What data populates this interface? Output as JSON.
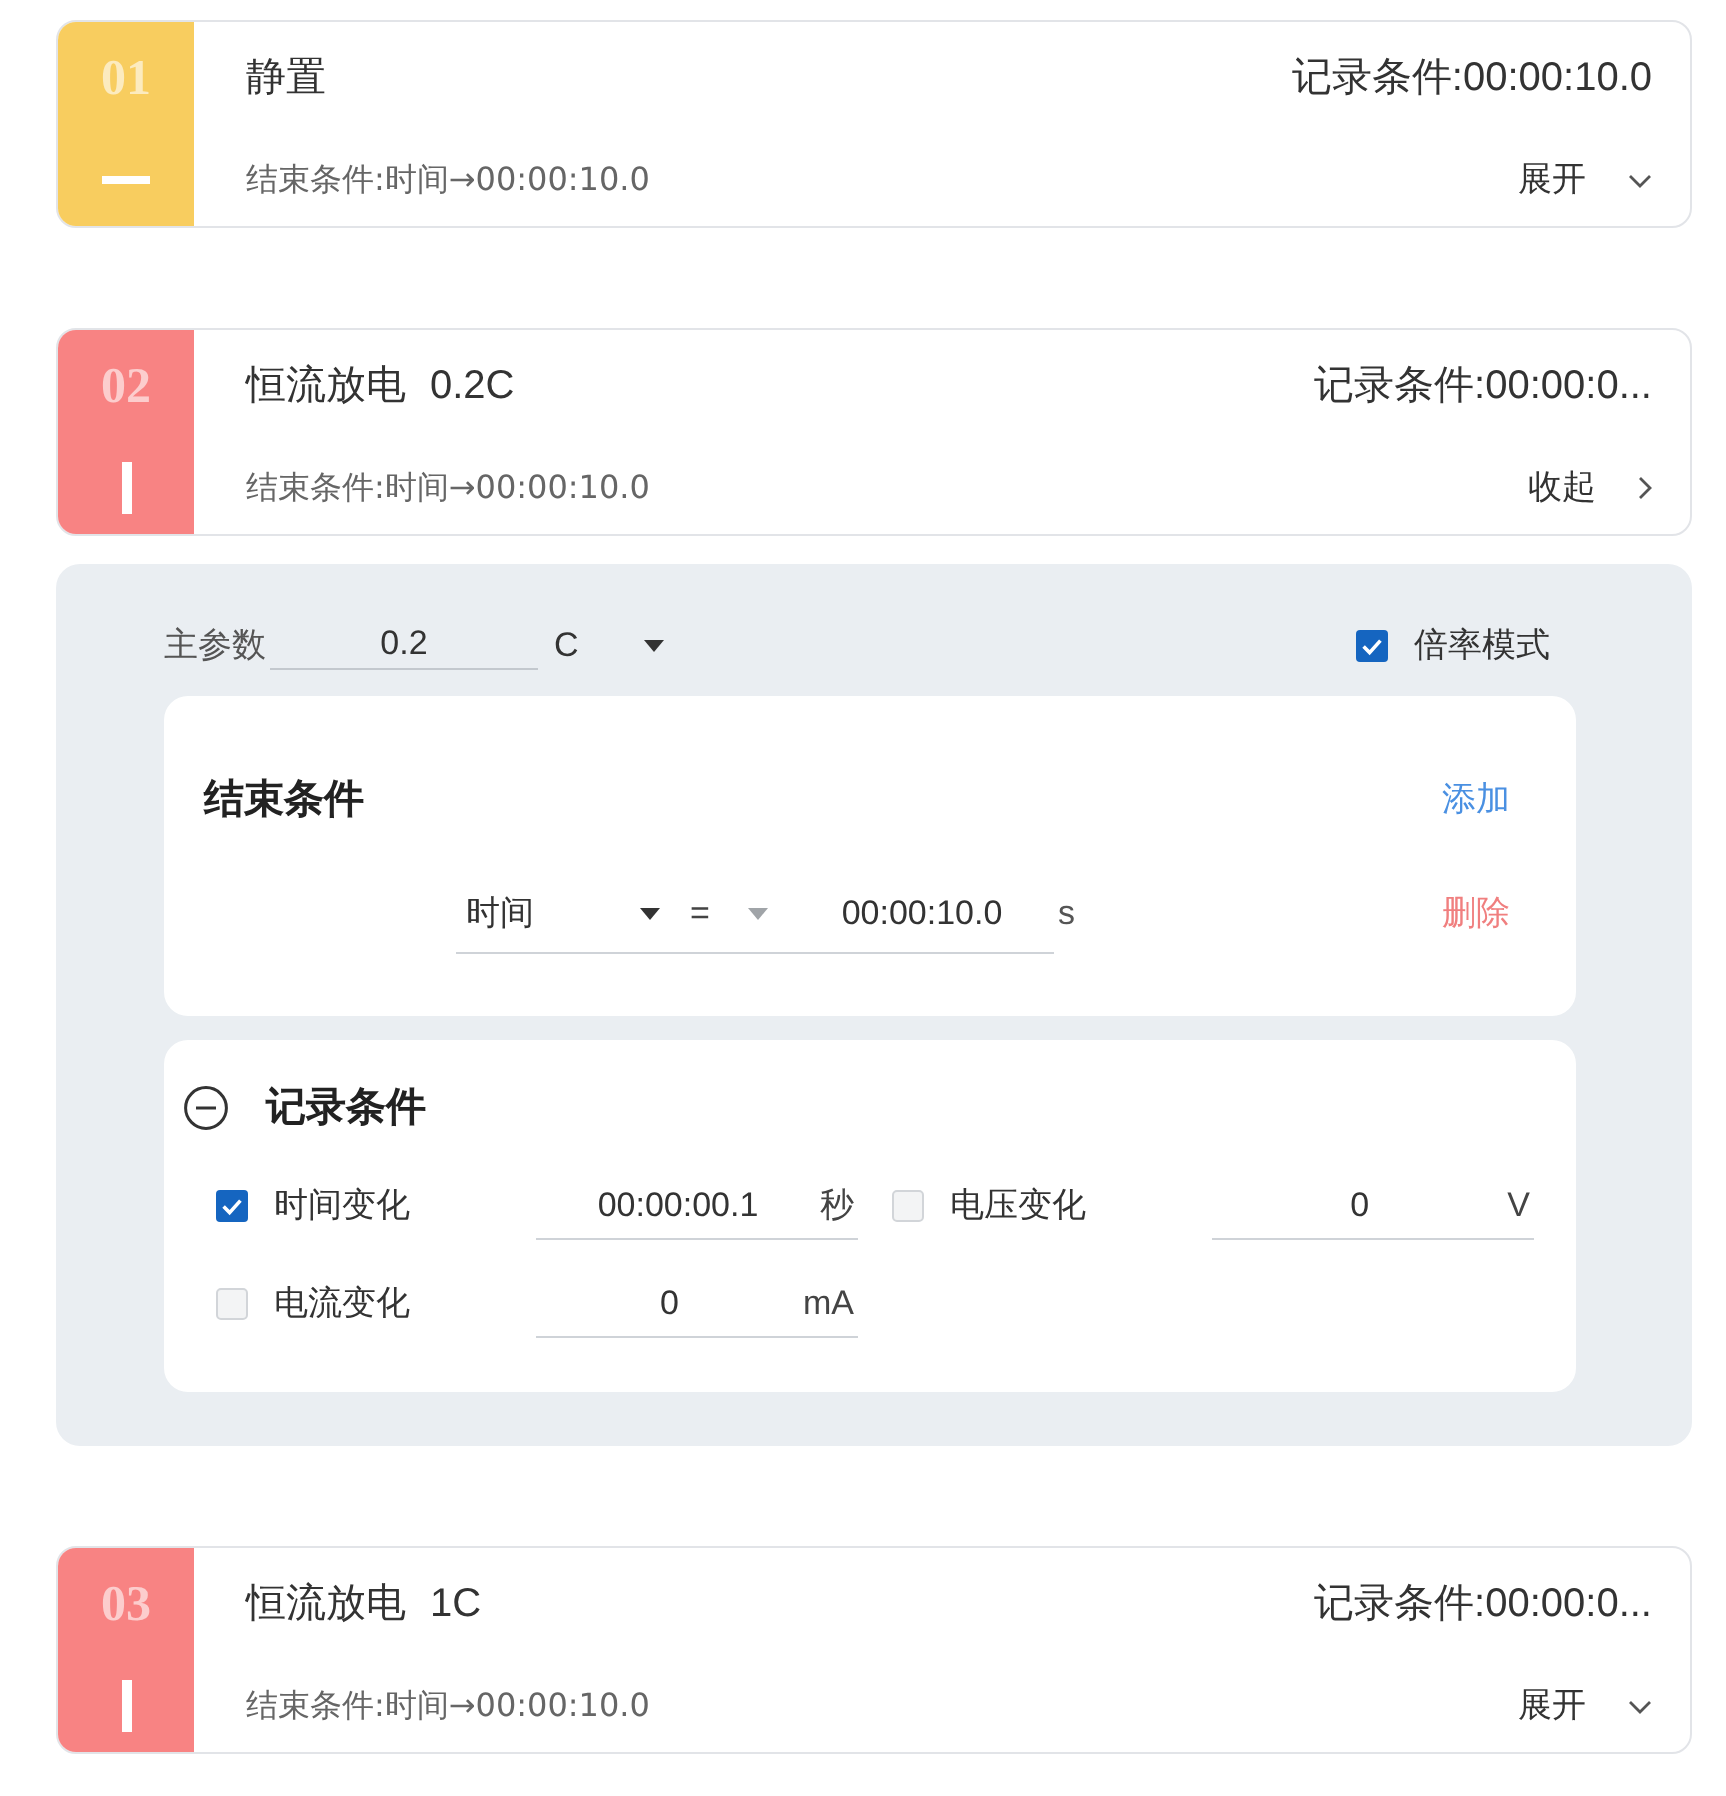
{
  "steps": [
    {
      "number": "01",
      "kind": "rest",
      "color": "#f8cd5f",
      "title": "静置",
      "record_condition": "记录条件:00:00:10.0",
      "end_condition": "结束条件:时间→00:00:10.0",
      "toggle_label": "展开",
      "expanded": false
    },
    {
      "number": "02",
      "kind": "discharge",
      "color": "#f88383",
      "title": "恒流放电",
      "rate": "0.2C",
      "record_condition": "记录条件:00:00:0...",
      "end_condition": "结束条件:时间→00:00:10.0",
      "toggle_label": "收起",
      "expanded": true,
      "details": {
        "main_param": {
          "label": "主参数",
          "value": "0.2",
          "unit": "C"
        },
        "rate_mode": {
          "label": "倍率模式",
          "checked": true
        },
        "end_conditions": {
          "title": "结束条件",
          "add_label": "添加",
          "rows": [
            {
              "type": "时间",
              "operator": "=",
              "value": "00:00:10.0",
              "unit": "s",
              "delete_label": "删除"
            }
          ]
        },
        "record_conditions": {
          "title": "记录条件",
          "items": [
            {
              "label": "时间变化",
              "checked": true,
              "value": "00:00:00.1",
              "unit": "秒"
            },
            {
              "label": "电压变化",
              "checked": false,
              "value": "0",
              "unit": "V"
            },
            {
              "label": "电流变化",
              "checked": false,
              "value": "0",
              "unit": "mA"
            }
          ]
        }
      }
    },
    {
      "number": "03",
      "kind": "discharge",
      "color": "#f88383",
      "title": "恒流放电",
      "rate": "1C",
      "record_condition": "记录条件:00:00:0...",
      "end_condition": "结束条件:时间→00:00:10.0",
      "toggle_label": "展开",
      "expanded": false
    }
  ]
}
